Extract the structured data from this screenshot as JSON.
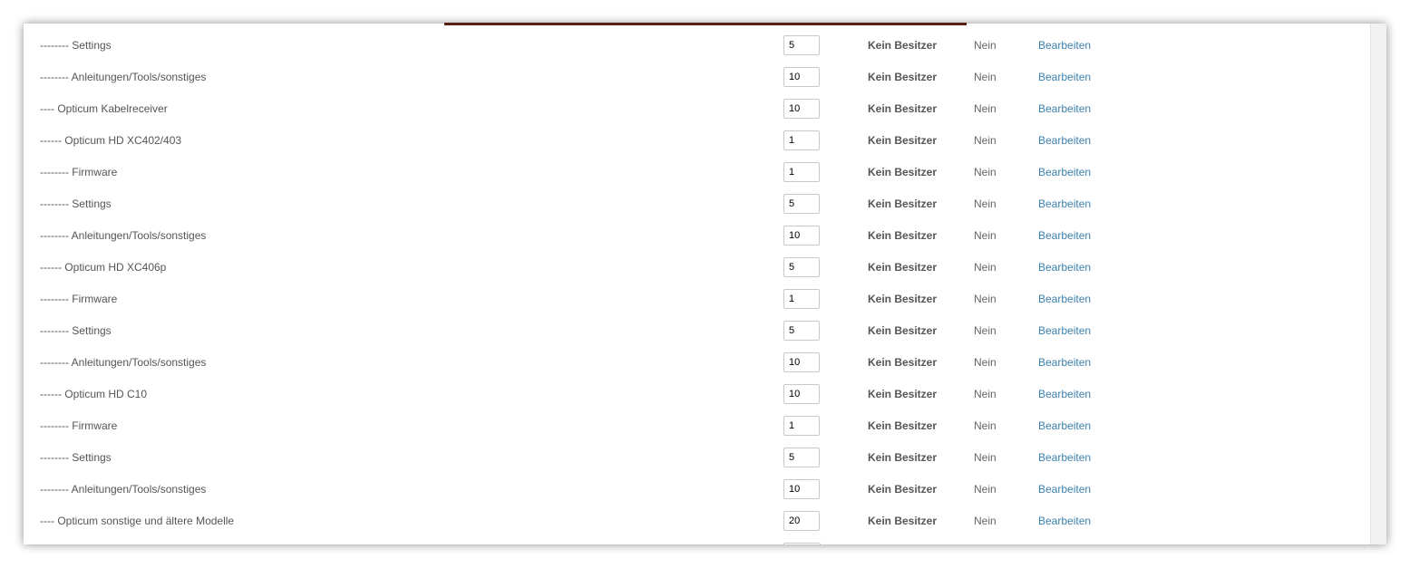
{
  "rows": [
    {
      "name": "-------- Settings",
      "order": "5",
      "owner": "Kein Besitzer",
      "flag": "Nein",
      "action": "Bearbeiten"
    },
    {
      "name": "-------- Anleitungen/Tools/sonstiges",
      "order": "10",
      "owner": "Kein Besitzer",
      "flag": "Nein",
      "action": "Bearbeiten"
    },
    {
      "name": "---- Opticum Kabelreceiver",
      "order": "10",
      "owner": "Kein Besitzer",
      "flag": "Nein",
      "action": "Bearbeiten"
    },
    {
      "name": "------ Opticum HD XC402/403",
      "order": "1",
      "owner": "Kein Besitzer",
      "flag": "Nein",
      "action": "Bearbeiten"
    },
    {
      "name": "-------- Firmware",
      "order": "1",
      "owner": "Kein Besitzer",
      "flag": "Nein",
      "action": "Bearbeiten"
    },
    {
      "name": "-------- Settings",
      "order": "5",
      "owner": "Kein Besitzer",
      "flag": "Nein",
      "action": "Bearbeiten"
    },
    {
      "name": "-------- Anleitungen/Tools/sonstiges",
      "order": "10",
      "owner": "Kein Besitzer",
      "flag": "Nein",
      "action": "Bearbeiten"
    },
    {
      "name": "------ Opticum HD XC406p",
      "order": "5",
      "owner": "Kein Besitzer",
      "flag": "Nein",
      "action": "Bearbeiten"
    },
    {
      "name": "-------- Firmware",
      "order": "1",
      "owner": "Kein Besitzer",
      "flag": "Nein",
      "action": "Bearbeiten"
    },
    {
      "name": "-------- Settings",
      "order": "5",
      "owner": "Kein Besitzer",
      "flag": "Nein",
      "action": "Bearbeiten"
    },
    {
      "name": "-------- Anleitungen/Tools/sonstiges",
      "order": "10",
      "owner": "Kein Besitzer",
      "flag": "Nein",
      "action": "Bearbeiten"
    },
    {
      "name": "------ Opticum HD C10",
      "order": "10",
      "owner": "Kein Besitzer",
      "flag": "Nein",
      "action": "Bearbeiten"
    },
    {
      "name": "-------- Firmware",
      "order": "1",
      "owner": "Kein Besitzer",
      "flag": "Nein",
      "action": "Bearbeiten"
    },
    {
      "name": "-------- Settings",
      "order": "5",
      "owner": "Kein Besitzer",
      "flag": "Nein",
      "action": "Bearbeiten"
    },
    {
      "name": "-------- Anleitungen/Tools/sonstiges",
      "order": "10",
      "owner": "Kein Besitzer",
      "flag": "Nein",
      "action": "Bearbeiten"
    },
    {
      "name": "---- Opticum sonstige und ältere Modelle",
      "order": "20",
      "owner": "Kein Besitzer",
      "flag": "Nein",
      "action": "Bearbeiten"
    }
  ],
  "colors": {
    "link": "#3c80ad",
    "text": "#555555",
    "accent_bar": "#5a1d12"
  }
}
